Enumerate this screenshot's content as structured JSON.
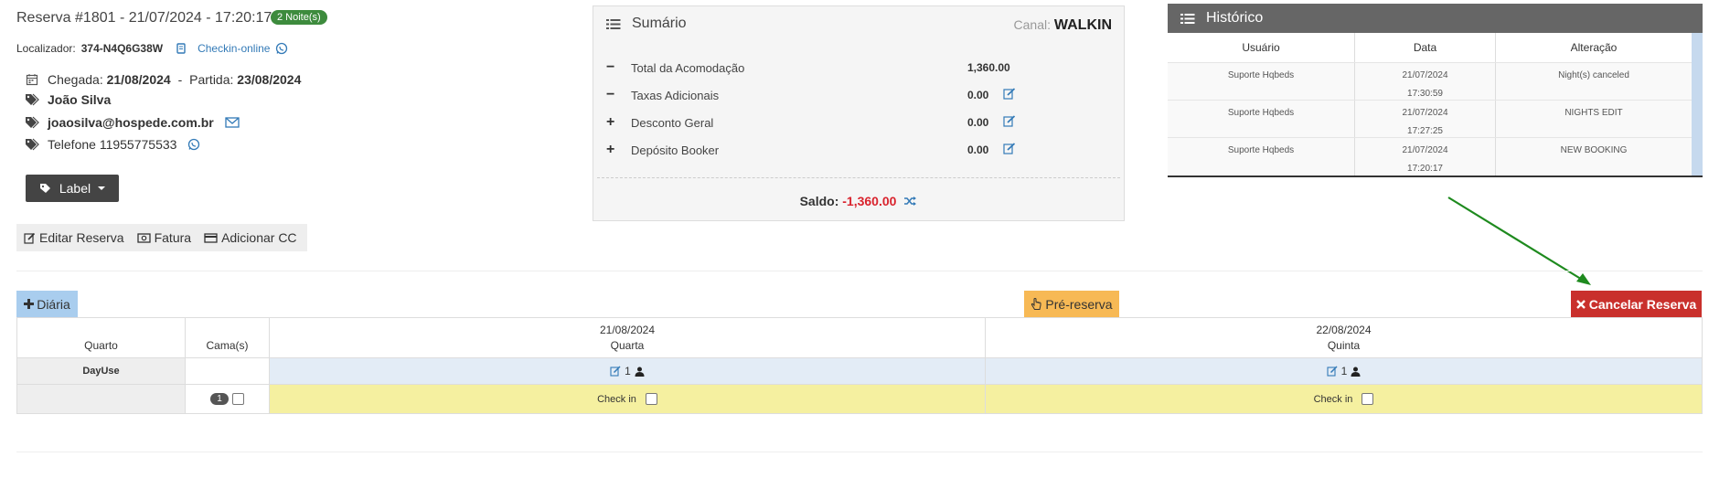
{
  "header": {
    "title": "Reserva #1801 - 21/07/2024 - 17:20:17",
    "nights_badge": "2 Noite(s)",
    "localizador_label": "Localizador:",
    "localizador_value": "374-N4Q6G38W",
    "checkin_online": "Checkin-online",
    "chegada_label": "Chegada:",
    "chegada_value": "21/08/2024",
    "separator": "-",
    "partida_label": "Partida:",
    "partida_value": "23/08/2024",
    "guest_name": "João Silva",
    "email": "joaosilva@hospede.com.br",
    "phone": "Telefone 11955775533",
    "label_button": "Label"
  },
  "actions": {
    "edit": "Editar Reserva",
    "invoice": "Fatura",
    "add_cc": "Adicionar CC"
  },
  "summary": {
    "title": "Sumário",
    "canal_label": "Canal:",
    "canal_value": "WALKIN",
    "rows": [
      {
        "sign": "−",
        "label": "Total da Acomodação",
        "value": "1,360.00",
        "editable": false
      },
      {
        "sign": "−",
        "label": "Taxas Adicionais",
        "value": "0.00",
        "editable": true
      },
      {
        "sign": "+",
        "label": "Desconto Geral",
        "value": "0.00",
        "editable": true
      },
      {
        "sign": "+",
        "label": "Depósito Booker",
        "value": "0.00",
        "editable": true
      }
    ],
    "saldo_label": "Saldo:",
    "saldo_value": "-1,360.00"
  },
  "history": {
    "title": "Histórico",
    "columns": [
      "Usuário",
      "Data",
      "Alteração"
    ],
    "rows": [
      {
        "user": "Suporte Hqbeds",
        "date": "21/07/2024",
        "time": "17:30:59",
        "change": "Night(s) canceled"
      },
      {
        "user": "Suporte Hqbeds",
        "date": "21/07/2024",
        "time": "17:27:25",
        "change": "NIGHTS EDIT"
      },
      {
        "user": "Suporte Hqbeds",
        "date": "21/07/2024",
        "time": "17:20:17",
        "change": "NEW BOOKING"
      }
    ]
  },
  "toolbar": {
    "diaria": "Diária",
    "prereserva": "Pré-reserva",
    "cancel": "Cancelar Reserva"
  },
  "grid": {
    "col_quarto": "Quarto",
    "col_camas": "Cama(s)",
    "days": [
      {
        "date": "21/08/2024",
        "weekday": "Quarta",
        "guests": "1",
        "checkin_label": "Check in"
      },
      {
        "date": "22/08/2024",
        "weekday": "Quinta",
        "guests": "1",
        "checkin_label": "Check in"
      }
    ],
    "room_name": "DayUse",
    "bed_number": "1"
  },
  "colors": {
    "badge_green": "#3d8b3d",
    "link_blue": "#337ab7",
    "saldo_red": "#d9232d",
    "cancel_red": "#c9302c",
    "prereserva_orange": "#f7b955",
    "diaria_blue": "#a9cdee",
    "checkin_yellow": "#f5f0a0",
    "guest_row_blue": "#e3ecf6",
    "arrow_green": "#1e8a1e"
  },
  "icons": [
    "calendar-icon",
    "tag-icon",
    "envelope-icon",
    "whatsapp-icon",
    "book-icon",
    "list-icon",
    "edit-icon",
    "shuffle-icon",
    "plus-icon",
    "hand-pointer-icon",
    "times-icon",
    "user-icon",
    "caret-down-icon",
    "money-icon",
    "credit-card-icon"
  ]
}
